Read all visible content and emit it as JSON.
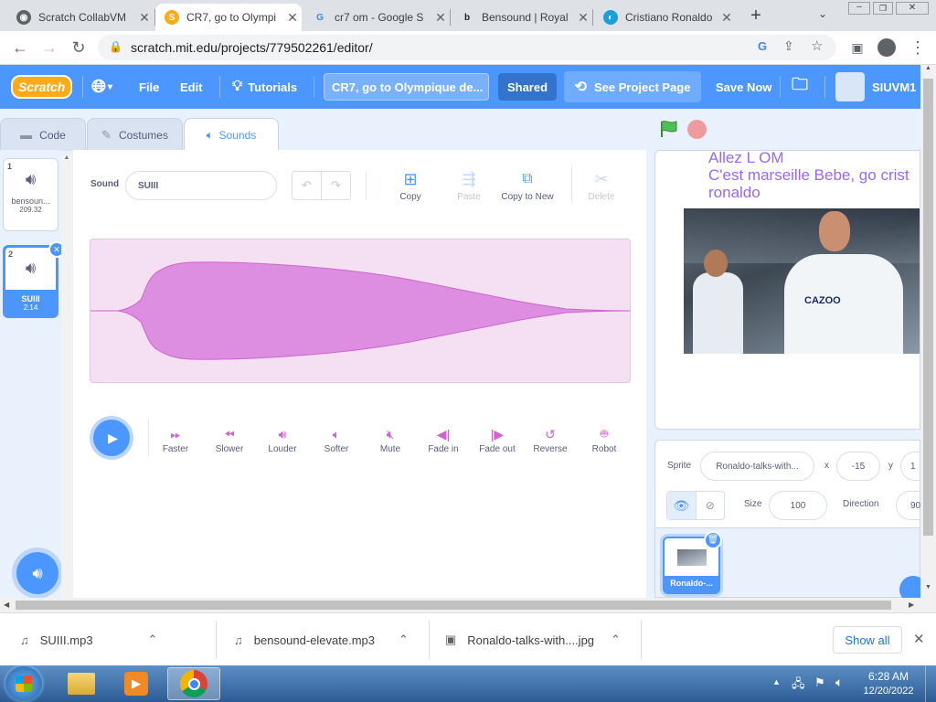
{
  "browser": {
    "tabs": [
      {
        "title": "Scratch CollabVM",
        "favicon": "collabvm-icon"
      },
      {
        "title": "CR7, go to Olympi",
        "favicon": "scratch-cat-icon"
      },
      {
        "title": "cr7 om - Google S",
        "favicon": "google-icon"
      },
      {
        "title": "Bensound | Royal",
        "favicon": "bensound-icon"
      },
      {
        "title": "Cristiano Ronaldo",
        "favicon": "web-icon"
      }
    ],
    "url": "scratch.mit.edu/projects/779502261/editor/"
  },
  "menu": {
    "logo": "Scratch",
    "file": "File",
    "edit": "Edit",
    "tutorials": "Tutorials",
    "project_title": "CR7, go to Olympique de...",
    "shared": "Shared",
    "see_project": "See Project Page",
    "save_now": "Save Now",
    "username": "SIUVM1"
  },
  "editor_tabs": {
    "code": "Code",
    "costumes": "Costumes",
    "sounds": "Sounds"
  },
  "sounds": [
    {
      "num": "1",
      "name": "bensoun...",
      "duration": "209.32"
    },
    {
      "num": "2",
      "name": "SUIII",
      "duration": "2.14"
    }
  ],
  "sound_editor": {
    "sound_label": "Sound",
    "sound_name": "SUIII",
    "tools": {
      "copy": "Copy",
      "paste": "Paste",
      "copy_to_new": "Copy to New",
      "delete": "Delete"
    },
    "effects": [
      "Faster",
      "Slower",
      "Louder",
      "Softer",
      "Mute",
      "Fade in",
      "Fade out",
      "Reverse",
      "Robot"
    ]
  },
  "stage": {
    "line1": "Allez L OM",
    "line2": "C'est marseille Bebe, go crist",
    "line3": "ronaldo",
    "image_label": "CAZOO"
  },
  "sprite_info": {
    "sprite_label": "Sprite",
    "sprite_name": "Ronaldo-talks-with...",
    "x_label": "x",
    "x_value": "-15",
    "y_label": "y",
    "y_value": "1",
    "size_label": "Size",
    "size_value": "100",
    "direction_label": "Direction",
    "direction_value": "90"
  },
  "sprite_thumb": {
    "name": "Ronaldo-..."
  },
  "downloads": {
    "items": [
      "SUIII.mp3",
      "bensound-elevate.mp3",
      "Ronaldo-talks-with....jpg"
    ],
    "show_all": "Show all"
  },
  "taskbar": {
    "time": "6:28 AM",
    "date": "12/20/2022"
  },
  "colors": {
    "scratch_blue": "#4c97ff",
    "sound_pink": "#cf63cf",
    "wave_fill": "#dd8ee0"
  }
}
